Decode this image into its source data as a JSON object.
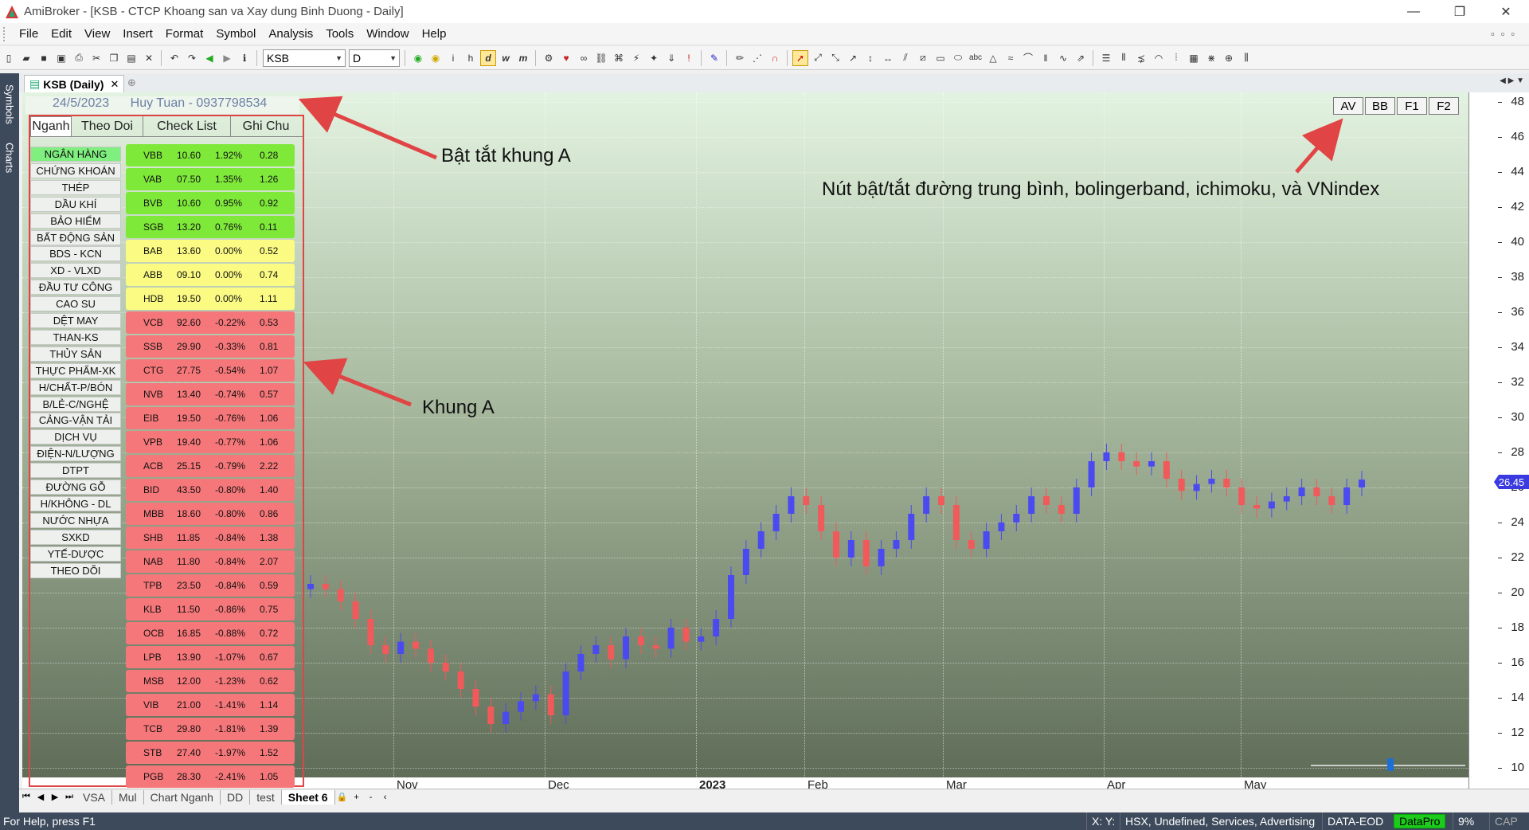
{
  "window": {
    "title": "AmiBroker - [KSB - CTCP Khoang san va Xay dung Binh Duong - Daily]",
    "controls": [
      "—",
      "❐",
      "✕"
    ]
  },
  "menu": [
    "File",
    "Edit",
    "View",
    "Insert",
    "Format",
    "Symbol",
    "Analysis",
    "Tools",
    "Window",
    "Help"
  ],
  "toolbar": {
    "symbol": "KSB",
    "interval": "D",
    "interval_buttons": [
      "d",
      "w",
      "m"
    ]
  },
  "side_tabs": [
    "Symbols",
    "Charts"
  ],
  "doc_tab": {
    "label": "KSB (Daily)",
    "close": "✕"
  },
  "panel": {
    "date": "24/5/2023",
    "contact": "Huy Tuan - 0937798534",
    "tabs": [
      "Nganh",
      "Theo Doi",
      "Check List",
      "Ghi Chu"
    ],
    "sectors": [
      "NGÂN HÀNG",
      "CHỨNG KHOÁN",
      "THÉP",
      "DẦU KHÍ",
      "BẢO HIỂM",
      "BẤT ĐỘNG SẢN",
      "BDS - KCN",
      "XD - VLXD",
      "ĐẦU TƯ CÔNG",
      "CAO SU",
      "DỆT MAY",
      "THAN-KS",
      "THỦY SẢN",
      "THỰC PHẨM-XK",
      "H/CHẤT-P/BÓN",
      "B/LẺ-C/NGHỆ",
      "CẢNG-VẬN TẢI",
      "DỊCH VỤ",
      "ĐIỆN-N/LƯỢNG",
      "DTPT",
      "ĐƯỜNG GỖ",
      "H/KHÔNG - DL",
      "NƯỚC NHỰA",
      "SXKD",
      "YTẾ-DƯỢC",
      "THEO DÕI"
    ],
    "stocks": [
      {
        "sym": "VBB",
        "price": "10.60",
        "chg": "1.92%",
        "vol": "0.28",
        "color": "g"
      },
      {
        "sym": "VAB",
        "price": "07.50",
        "chg": "1.35%",
        "vol": "1.26",
        "color": "g"
      },
      {
        "sym": "BVB",
        "price": "10.60",
        "chg": "0.95%",
        "vol": "0.92",
        "color": "g"
      },
      {
        "sym": "SGB",
        "price": "13.20",
        "chg": "0.76%",
        "vol": "0.11",
        "color": "g"
      },
      {
        "sym": "BAB",
        "price": "13.60",
        "chg": "0.00%",
        "vol": "0.52",
        "color": "y"
      },
      {
        "sym": "ABB",
        "price": "09.10",
        "chg": "0.00%",
        "vol": "0.74",
        "color": "y"
      },
      {
        "sym": "HDB",
        "price": "19.50",
        "chg": "0.00%",
        "vol": "1.11",
        "color": "y"
      },
      {
        "sym": "VCB",
        "price": "92.60",
        "chg": "-0.22%",
        "vol": "0.53",
        "color": "r"
      },
      {
        "sym": "SSB",
        "price": "29.90",
        "chg": "-0.33%",
        "vol": "0.81",
        "color": "r"
      },
      {
        "sym": "CTG",
        "price": "27.75",
        "chg": "-0.54%",
        "vol": "1.07",
        "color": "r"
      },
      {
        "sym": "NVB",
        "price": "13.40",
        "chg": "-0.74%",
        "vol": "0.57",
        "color": "r"
      },
      {
        "sym": "EIB",
        "price": "19.50",
        "chg": "-0.76%",
        "vol": "1.06",
        "color": "r"
      },
      {
        "sym": "VPB",
        "price": "19.40",
        "chg": "-0.77%",
        "vol": "1.06",
        "color": "r"
      },
      {
        "sym": "ACB",
        "price": "25.15",
        "chg": "-0.79%",
        "vol": "2.22",
        "color": "r"
      },
      {
        "sym": "BID",
        "price": "43.50",
        "chg": "-0.80%",
        "vol": "1.40",
        "color": "r"
      },
      {
        "sym": "MBB",
        "price": "18.60",
        "chg": "-0.80%",
        "vol": "0.86",
        "color": "r"
      },
      {
        "sym": "SHB",
        "price": "11.85",
        "chg": "-0.84%",
        "vol": "1.38",
        "color": "r"
      },
      {
        "sym": "NAB",
        "price": "11.80",
        "chg": "-0.84%",
        "vol": "2.07",
        "color": "r"
      },
      {
        "sym": "TPB",
        "price": "23.50",
        "chg": "-0.84%",
        "vol": "0.59",
        "color": "r"
      },
      {
        "sym": "KLB",
        "price": "11.50",
        "chg": "-0.86%",
        "vol": "0.75",
        "color": "r"
      },
      {
        "sym": "OCB",
        "price": "16.85",
        "chg": "-0.88%",
        "vol": "0.72",
        "color": "r"
      },
      {
        "sym": "LPB",
        "price": "13.90",
        "chg": "-1.07%",
        "vol": "0.67",
        "color": "r"
      },
      {
        "sym": "MSB",
        "price": "12.00",
        "chg": "-1.23%",
        "vol": "0.62",
        "color": "r"
      },
      {
        "sym": "VIB",
        "price": "21.00",
        "chg": "-1.41%",
        "vol": "1.14",
        "color": "r"
      },
      {
        "sym": "TCB",
        "price": "29.80",
        "chg": "-1.81%",
        "vol": "1.39",
        "color": "r"
      },
      {
        "sym": "STB",
        "price": "27.40",
        "chg": "-1.97%",
        "vol": "1.52",
        "color": "r"
      },
      {
        "sym": "PGB",
        "price": "28.30",
        "chg": "-2.41%",
        "vol": "1.05",
        "color": "r"
      }
    ]
  },
  "chart_buttons": [
    "AV",
    "BB",
    "F1",
    "F2"
  ],
  "annotations": {
    "toggle_panel": "Bật tắt khung A",
    "panel_label": "Khung A",
    "buttons_note": "Nút bật/tắt đường trung bình, bolingerband, ichimoku, và VNindex"
  },
  "chart_data": {
    "type": "candlestick",
    "symbol": "KSB",
    "ylim": [
      10,
      48
    ],
    "y_ticks": [
      "48",
      "46",
      "44",
      "42",
      "40",
      "38",
      "36",
      "34",
      "32",
      "30",
      "28",
      "26",
      "24",
      "22",
      "20",
      "18",
      "16",
      "14",
      "12",
      "10"
    ],
    "x_ticks": [
      "Nov",
      "Dec",
      "2023",
      "Feb",
      "Mar",
      "Apr",
      "May"
    ],
    "last_price": "26.45",
    "colors": {
      "up": "#4a4af0",
      "down": "#f05a5a"
    },
    "closes_approx": [
      20.5,
      20.2,
      19.5,
      18.5,
      17.0,
      16.5,
      17.2,
      16.8,
      16.0,
      15.5,
      14.5,
      13.5,
      12.5,
      13.2,
      13.8,
      14.2,
      13.0,
      15.5,
      16.5,
      17.0,
      16.2,
      17.5,
      17.0,
      16.8,
      18.0,
      17.2,
      17.5,
      18.5,
      21.0,
      22.5,
      23.5,
      24.5,
      25.5,
      25.0,
      23.5,
      22.0,
      23.0,
      21.5,
      22.5,
      23.0,
      24.5,
      25.5,
      25.0,
      23.0,
      22.5,
      23.5,
      24.0,
      24.5,
      25.5,
      25.0,
      24.5,
      26.0,
      27.5,
      28.0,
      27.5,
      27.2,
      27.5,
      26.5,
      25.8,
      26.2,
      26.5,
      26.0,
      25.0,
      24.8,
      25.2,
      25.5,
      26.0,
      25.5,
      25.0,
      26.0,
      26.45
    ]
  },
  "sheets": [
    "VSA",
    "Mul",
    "Chart Nganh",
    "DD",
    "test",
    "Sheet 6"
  ],
  "status": {
    "help": "For Help, press F1",
    "xy": "X:  Y:",
    "info": "HSX, Undefined, Services, Advertising",
    "data_src": "DATA-EOD",
    "plugin": "DataPro",
    "pct": "9%",
    "cap": "CAP"
  }
}
